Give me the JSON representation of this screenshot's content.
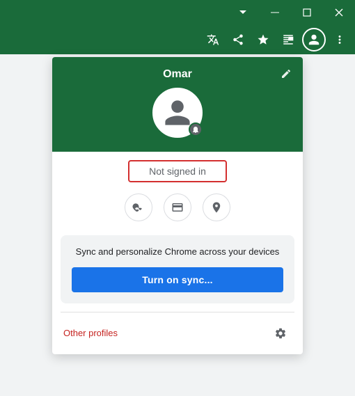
{
  "titlebar": {
    "controls": {
      "chevron_down": "⌄",
      "minimize": "—",
      "maximize": "□",
      "close": "✕"
    }
  },
  "toolbar": {
    "icons": [
      "translate",
      "share",
      "star",
      "tab",
      "profile",
      "menu"
    ]
  },
  "profile": {
    "name": "Omar",
    "not_signed_in": "Not signed in",
    "edit_label": "Edit avatar"
  },
  "quick_icons": {
    "key": "Passwords",
    "card": "Payment methods",
    "location": "Addresses"
  },
  "sync": {
    "description": "Sync and personalize Chrome across your devices",
    "button_label": "Turn on sync..."
  },
  "other_profiles": {
    "label": "Other profiles",
    "settings_label": "Manage profiles"
  }
}
